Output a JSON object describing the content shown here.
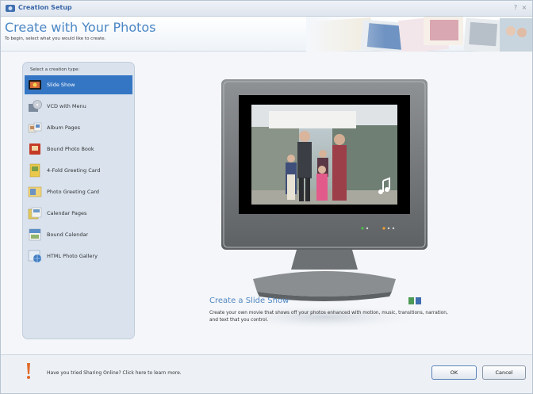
{
  "window": {
    "title": "Creation Setup",
    "controls": [
      "?",
      "×"
    ]
  },
  "header": {
    "title": "Create with Your Photos",
    "subtitle": "To begin, select what you would like to create."
  },
  "sidebar": {
    "label": "Select a creation type:",
    "items": [
      {
        "label": "Slide Show",
        "icon": "slideshow-icon",
        "selected": true
      },
      {
        "label": "VCD with Menu",
        "icon": "vcd-icon",
        "selected": false
      },
      {
        "label": "Album Pages",
        "icon": "album-pages-icon",
        "selected": false
      },
      {
        "label": "Bound Photo Book",
        "icon": "photo-book-icon",
        "selected": false
      },
      {
        "label": "4-Fold Greeting Card",
        "icon": "greeting-card-4fold-icon",
        "selected": false
      },
      {
        "label": "Photo Greeting Card",
        "icon": "photo-greeting-card-icon",
        "selected": false
      },
      {
        "label": "Calendar Pages",
        "icon": "calendar-pages-icon",
        "selected": false
      },
      {
        "label": "Bound Calendar",
        "icon": "bound-calendar-icon",
        "selected": false
      },
      {
        "label": "HTML Photo Gallery",
        "icon": "html-gallery-icon",
        "selected": false
      }
    ]
  },
  "preview": {
    "title": "Create a Slide Show",
    "description": "Create your own movie that shows off your photos enhanced with motion, music, transitions, narration, and text that you control."
  },
  "footer": {
    "tip": "Have you tried Sharing Online? Click here to learn more.",
    "ok_label": "OK",
    "cancel_label": "Cancel"
  },
  "colors": {
    "accent": "#3576c4",
    "title_blue": "#4a86c5",
    "sidebar_bg": "#d9e2ed"
  }
}
